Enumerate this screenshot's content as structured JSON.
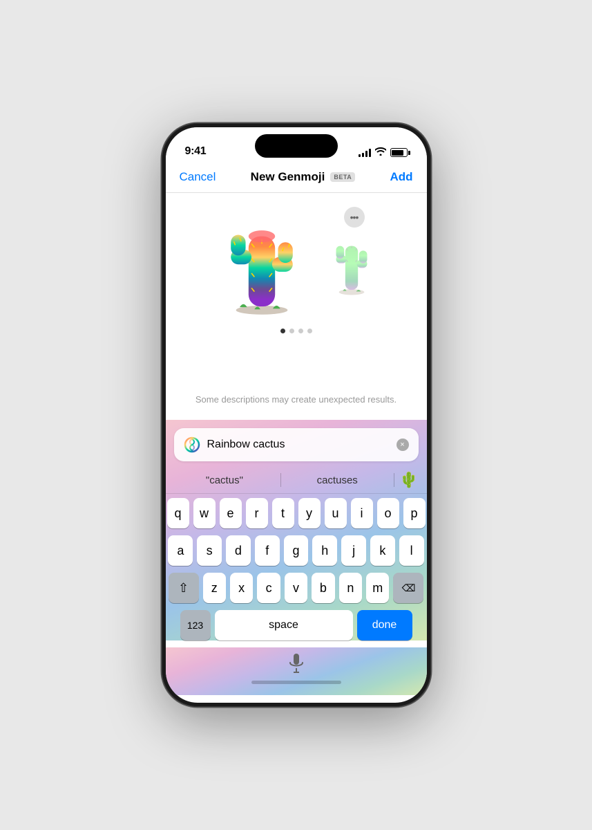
{
  "phone": {
    "status_bar": {
      "time": "9:41"
    },
    "nav": {
      "cancel_label": "Cancel",
      "title": "New Genmoji",
      "beta_label": "BETA",
      "add_label": "Add"
    },
    "warning": {
      "text": "Some descriptions may create unexpected results."
    },
    "search": {
      "value": "Rainbow cactus",
      "clear_label": "×"
    },
    "autocomplete": {
      "items": [
        {
          "label": "\"cactus\""
        },
        {
          "label": "cactuses"
        },
        {
          "label": "🌵"
        }
      ]
    },
    "keyboard": {
      "rows": [
        [
          "q",
          "w",
          "e",
          "r",
          "t",
          "y",
          "u",
          "i",
          "o",
          "p"
        ],
        [
          "a",
          "s",
          "d",
          "f",
          "g",
          "h",
          "j",
          "k",
          "l"
        ],
        [
          "z",
          "x",
          "c",
          "v",
          "b",
          "n",
          "m"
        ]
      ],
      "num_label": "123",
      "space_label": "space",
      "done_label": "done"
    },
    "page_dots": [
      {
        "active": true
      },
      {
        "active": false
      },
      {
        "active": false
      },
      {
        "active": false
      }
    ]
  }
}
